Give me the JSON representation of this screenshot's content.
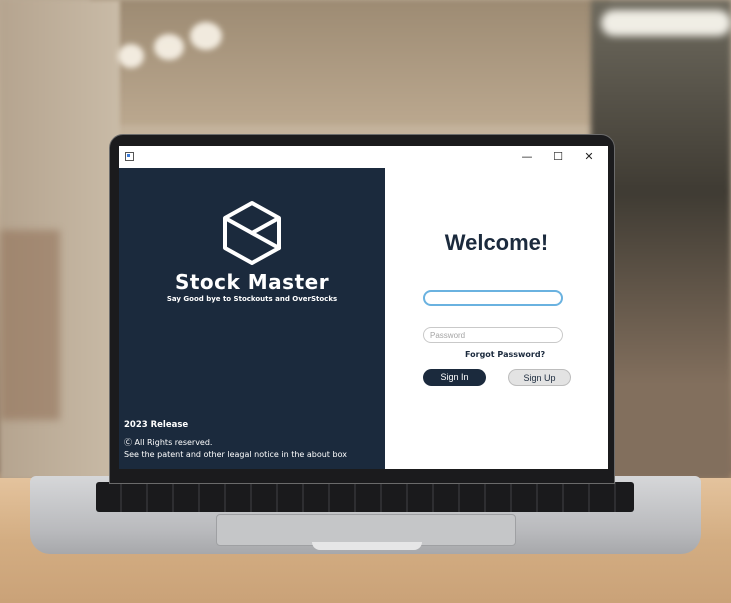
{
  "window": {
    "minimize": "—",
    "maximize": "☐",
    "close": "✕"
  },
  "brand": {
    "name": "Stock Master",
    "tagline": "Say Good bye to Stockouts and OverStocks",
    "release": "2023 Release",
    "rights": "Ⓒ All Rights reserved.",
    "notice": "See the patent and other leagal notice in the about box"
  },
  "login": {
    "title": "Welcome!",
    "username_placeholder": "",
    "password_placeholder": "Password",
    "forgot": "Forgot Password?",
    "sign_in": "Sign In",
    "sign_up": "Sign Up"
  },
  "colors": {
    "primary": "#1b2a3d",
    "focus": "#6ab2e0"
  }
}
